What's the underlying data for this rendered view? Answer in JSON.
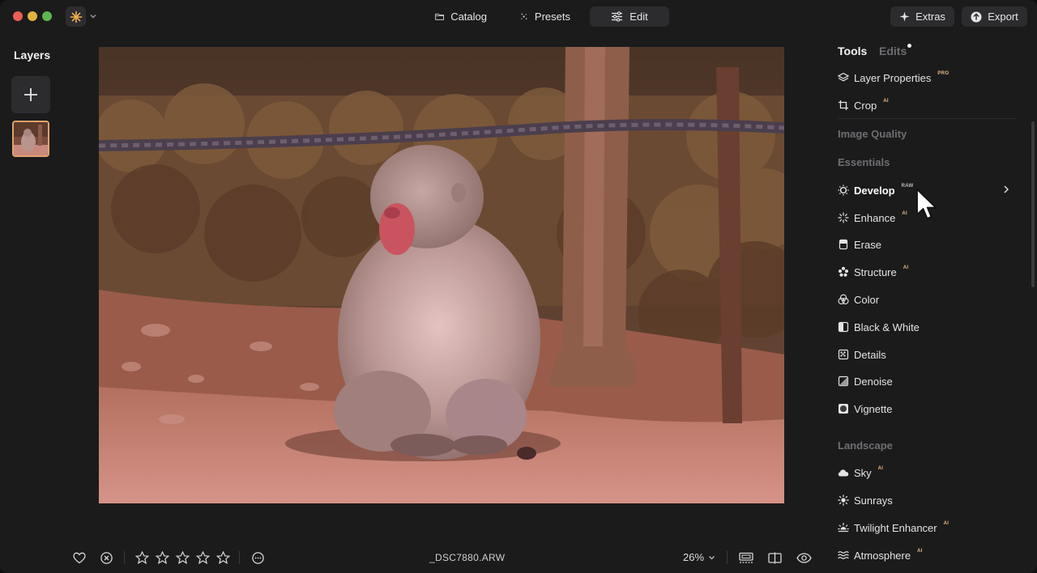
{
  "window": {
    "modes": [
      {
        "label": "Catalog",
        "icon": "folder-icon"
      },
      {
        "label": "Presets",
        "icon": "sparkle-icon"
      },
      {
        "label": "Edit",
        "icon": "sliders-icon",
        "active": true
      }
    ],
    "extras_label": "Extras",
    "export_label": "Export"
  },
  "layers": {
    "title": "Layers"
  },
  "bottombar": {
    "file_name": "_DSC7880.ARW",
    "zoom": "26%",
    "rating_stars": 0
  },
  "panel": {
    "tabs": {
      "tools": "Tools",
      "edits": "Edits"
    },
    "top_tools": [
      {
        "label": "Layer Properties",
        "badge": "PRO",
        "icon": "layers-icon"
      },
      {
        "label": "Crop",
        "badge": "AI",
        "icon": "crop-icon"
      }
    ],
    "sections": {
      "image_quality": "Image Quality",
      "essentials": "Essentials",
      "landscape": "Landscape"
    },
    "essentials_tools": [
      {
        "label": "Develop",
        "badge": "RAW",
        "icon": "develop-sun-icon",
        "active": true
      },
      {
        "label": "Enhance",
        "badge": "AI",
        "icon": "enhance-burst-icon"
      },
      {
        "label": "Erase",
        "badge": "",
        "icon": "eraser-icon"
      },
      {
        "label": "Structure",
        "badge": "AI",
        "icon": "structure-icon"
      },
      {
        "label": "Color",
        "badge": "",
        "icon": "color-circles-icon"
      },
      {
        "label": "Black & White",
        "badge": "",
        "icon": "black-white-icon"
      },
      {
        "label": "Details",
        "badge": "",
        "icon": "details-grid-icon"
      },
      {
        "label": "Denoise",
        "badge": "",
        "icon": "denoise-icon"
      },
      {
        "label": "Vignette",
        "badge": "",
        "icon": "vignette-icon"
      }
    ],
    "landscape_tools": [
      {
        "label": "Sky",
        "badge": "AI",
        "icon": "cloud-icon"
      },
      {
        "label": "Sunrays",
        "badge": "",
        "icon": "sunrays-icon"
      },
      {
        "label": "Twilight Enhancer",
        "badge": "AI",
        "icon": "twilight-icon"
      },
      {
        "label": "Atmosphere",
        "badge": "AI",
        "icon": "atmosphere-icon"
      }
    ]
  },
  "colors": {
    "window_bg": "#1b1b1c",
    "button_bg": "#2c2c2e",
    "badge_color": "#e9b98a",
    "section_color": "#6f6f73",
    "thumb_border": "#e0a36a"
  }
}
